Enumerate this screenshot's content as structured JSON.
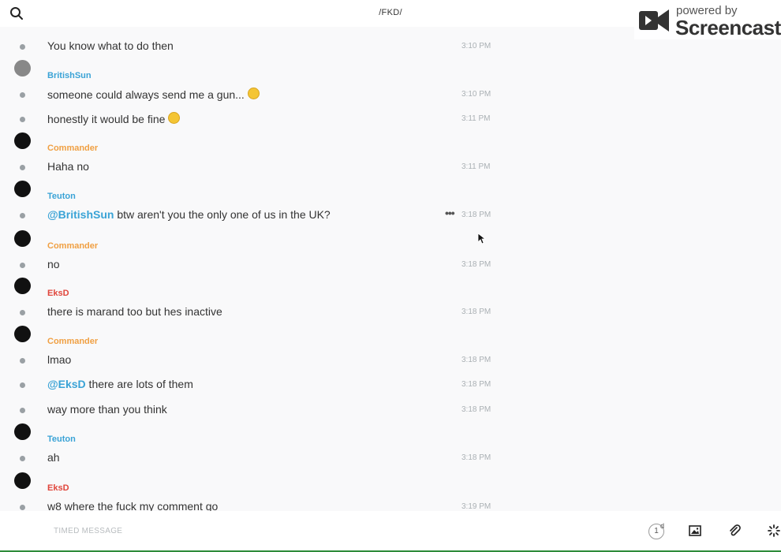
{
  "header": {
    "channel_title": "/FKD/",
    "search_icon": "search-icon"
  },
  "watermark": {
    "small": "powered by",
    "big": "Screencastify"
  },
  "messages": [
    {
      "author": "",
      "color": "",
      "avatar": "",
      "mention": "",
      "text": "You know what to do then",
      "time": "3:10 PM"
    },
    {
      "author": "BritishSun",
      "color": "#3aa3d6",
      "avatar": "grey",
      "mention": "",
      "text": "someone could always send me a gun...",
      "emoji": true,
      "time": "3:10 PM"
    },
    {
      "author": "",
      "color": "",
      "avatar": "",
      "mention": "",
      "text": "honestly it would be fine",
      "emoji": true,
      "time": "3:11 PM"
    },
    {
      "author": "Commander",
      "color": "#f0a043",
      "avatar": "dark",
      "mention": "",
      "text": "Haha no",
      "time": "3:11 PM"
    },
    {
      "author": "Teuton",
      "color": "#3aa3d6",
      "avatar": "dark",
      "mention": "@BritishSun",
      "text": " btw aren't you the only one of us in the UK?",
      "time": "3:18 PM",
      "more": "•••"
    },
    {
      "author": "Commander",
      "color": "#f0a043",
      "avatar": "dark",
      "mention": "",
      "text": "no",
      "time": "3:18 PM"
    },
    {
      "author": "EksD",
      "color": "#e0463c",
      "avatar": "dark",
      "mention": "",
      "text": "there is marand too but hes inactive",
      "time": "3:18 PM"
    },
    {
      "author": "Commander",
      "color": "#f0a043",
      "avatar": "dark",
      "mention": "",
      "text": "lmao",
      "time": "3:18 PM"
    },
    {
      "author": "",
      "color": "",
      "avatar": "",
      "mention": "@EksD",
      "text": " there are lots of them",
      "time": "3:18 PM"
    },
    {
      "author": "",
      "color": "",
      "avatar": "",
      "mention": "",
      "text": "way more than you think",
      "time": "3:18 PM"
    },
    {
      "author": "Teuton",
      "color": "#3aa3d6",
      "avatar": "dark",
      "mention": "",
      "text": "ah",
      "time": "3:18 PM"
    },
    {
      "author": "EksD",
      "color": "#e0463c",
      "avatar": "dark",
      "mention": "",
      "text": "w8 where the fuck my comment go",
      "time": "3:19 PM"
    }
  ],
  "composer": {
    "placeholder": "TIMED MESSAGE",
    "timer_value": "1",
    "timer_unit": "d",
    "icons": [
      "image-icon",
      "paperclip-icon",
      "sparkle-icon"
    ]
  },
  "colors": {
    "mention": "#3aa3d6",
    "composer_border": "#2e8b3a",
    "background": "#f9f9fa"
  }
}
